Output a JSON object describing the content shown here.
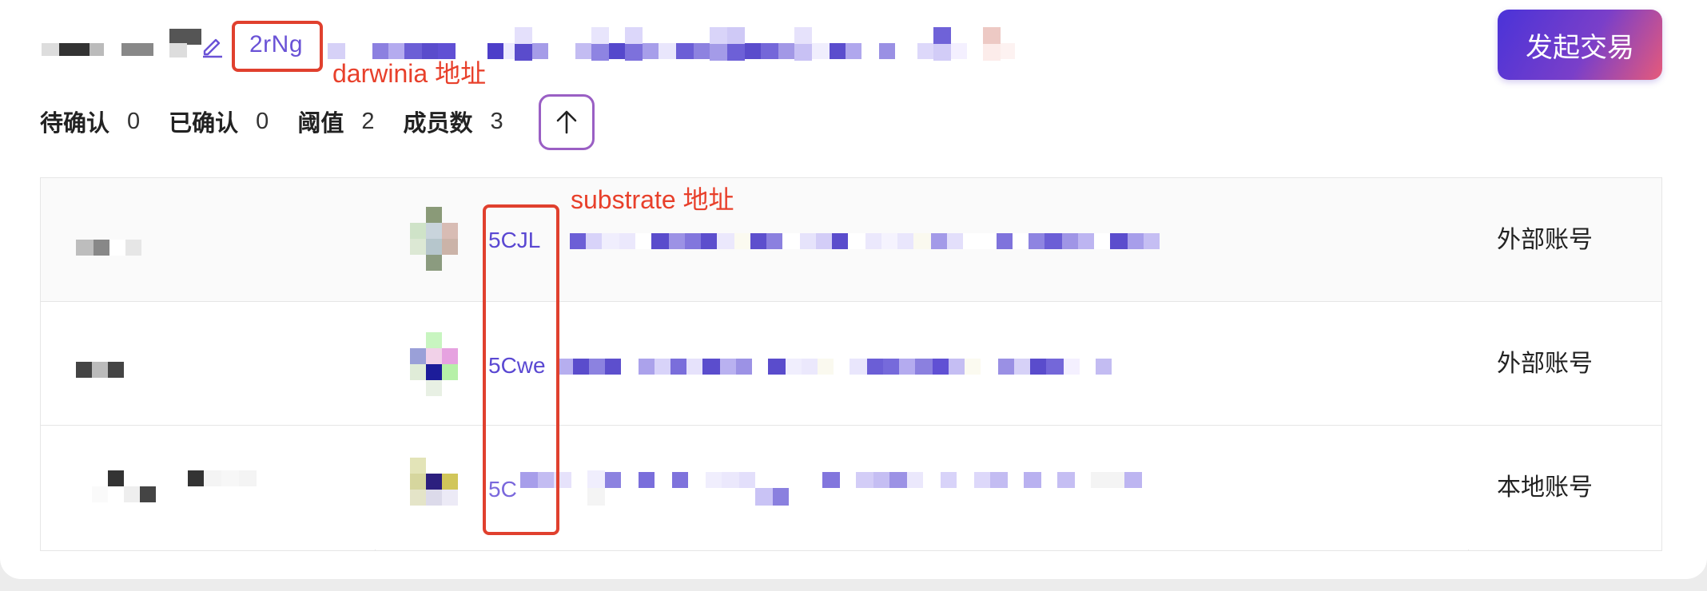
{
  "header": {
    "short_address": "2rNg",
    "edit_icon": "pencil-icon",
    "primary_action": "发起交易"
  },
  "annotations": {
    "darwinia_label": "darwinia 地址",
    "substrate_label": "substrate 地址",
    "color": "#e0402e"
  },
  "stats": {
    "pending_label": "待确认",
    "pending_value": "0",
    "confirmed_label": "已确认",
    "confirmed_value": "0",
    "threshold_label": "阈值",
    "threshold_value": "2",
    "members_label": "成员数",
    "members_value": "3",
    "toggle_icon": "arrow-up-icon"
  },
  "members": [
    {
      "address_prefix": "5CJL",
      "account_type": "外部账号"
    },
    {
      "address_prefix": "5Cwe",
      "account_type": "外部账号"
    },
    {
      "address_prefix": "5C",
      "account_type": "本地账号"
    }
  ],
  "colors": {
    "accent": "#6a52d6",
    "button_gradient_start": "#4a33d8",
    "button_gradient_end": "#e65a7a"
  }
}
